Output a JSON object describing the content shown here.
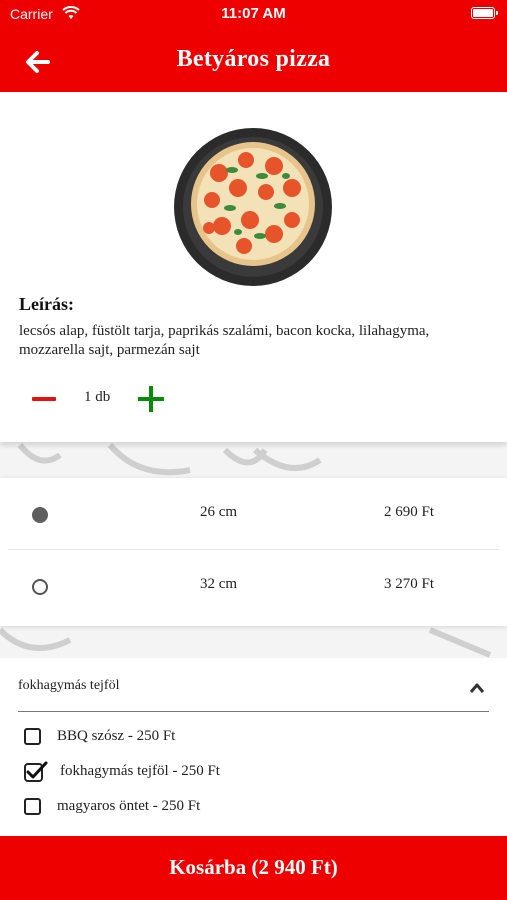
{
  "status_bar": {
    "carrier": "Carrier",
    "time": "11:07 AM"
  },
  "header": {
    "title": "Betyáros pizza",
    "back_icon": "arrow-left-icon"
  },
  "product": {
    "image": "pizza-image",
    "description_title": "Leírás:",
    "description": "lecsós alap, füstölt tarja, paprikás szalámi, bacon kocka, lilahagyma, mozzarella sajt, parmezán sajt",
    "quantity": "1 db"
  },
  "sizes": [
    {
      "size": "26 cm",
      "price": "2 690 Ft",
      "selected": true
    },
    {
      "size": "32 cm",
      "price": "3 270 Ft",
      "selected": false
    }
  ],
  "extras": {
    "header": "fokhagymás tejföl",
    "options": [
      {
        "label": "BBQ szósz - 250 Ft",
        "checked": false
      },
      {
        "label": "fokhagymás tejföl - 250 Ft",
        "checked": true
      },
      {
        "label": "magyaros öntet - 250 Ft",
        "checked": false
      }
    ]
  },
  "cart_button": {
    "label": "Kosárba (2 940 Ft)"
  },
  "colors": {
    "brand_red": "#ee0000",
    "plus_green": "#0a8a0a",
    "minus_red": "#e31010"
  }
}
